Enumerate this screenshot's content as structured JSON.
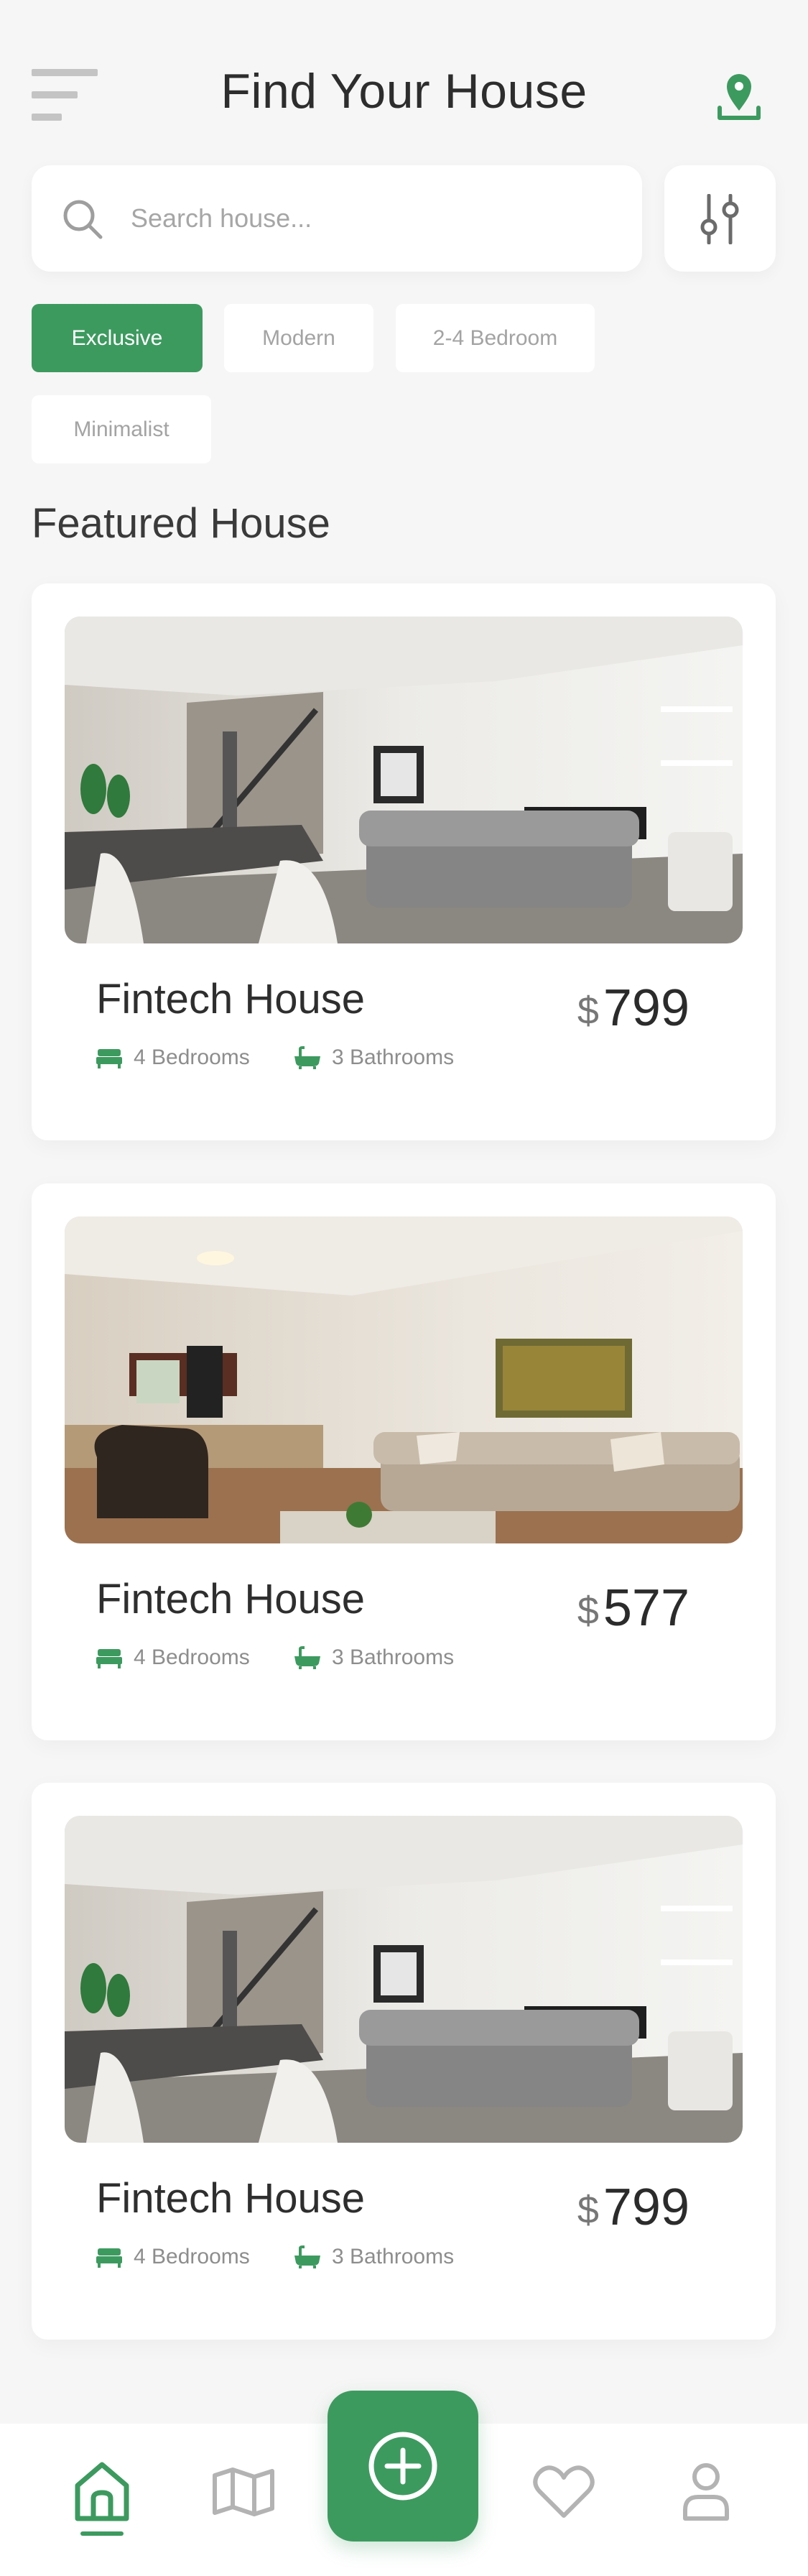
{
  "header": {
    "title": "Find Your House",
    "menu_icon": "hamburger-menu-icon",
    "location_icon": "map-pin-icon"
  },
  "search": {
    "placeholder": "Search house...",
    "value": "",
    "icon": "search-icon",
    "filter_icon": "sliders-icon"
  },
  "categories": [
    {
      "label": "Exclusive",
      "active": true
    },
    {
      "label": "Modern",
      "active": false
    },
    {
      "label": "2-4 Bedroom",
      "active": false
    },
    {
      "label": "Minimalist",
      "active": false
    }
  ],
  "section": {
    "title": "Featured House"
  },
  "listings": [
    {
      "title": "Fintech House",
      "currency": "$",
      "price": "799",
      "bedrooms": "4 Bedrooms",
      "bathrooms": "3 Bathrooms",
      "photo": "living-room-with-staircase"
    },
    {
      "title": "Fintech House",
      "currency": "$",
      "price": "577",
      "bedrooms": "4 Bedrooms",
      "bathrooms": "3 Bathrooms",
      "photo": "living-room-with-kitchen"
    },
    {
      "title": "Fintech House",
      "currency": "$",
      "price": "799",
      "bedrooms": "4 Bedrooms",
      "bathrooms": "3 Bathrooms",
      "photo": "living-room-with-staircase"
    }
  ],
  "bottom_nav": {
    "items": [
      {
        "name": "home",
        "icon": "home-icon",
        "active": true
      },
      {
        "name": "map",
        "icon": "map-icon",
        "active": false
      },
      {
        "name": "add",
        "icon": "plus-circle-icon",
        "active": false
      },
      {
        "name": "favorites",
        "icon": "heart-icon",
        "active": false
      },
      {
        "name": "profile",
        "icon": "user-icon",
        "active": false
      }
    ]
  },
  "colors": {
    "accent": "#3d9a5f",
    "background": "#f6f6f6",
    "card": "#ffffff",
    "muted_text": "#a3a3a3"
  }
}
